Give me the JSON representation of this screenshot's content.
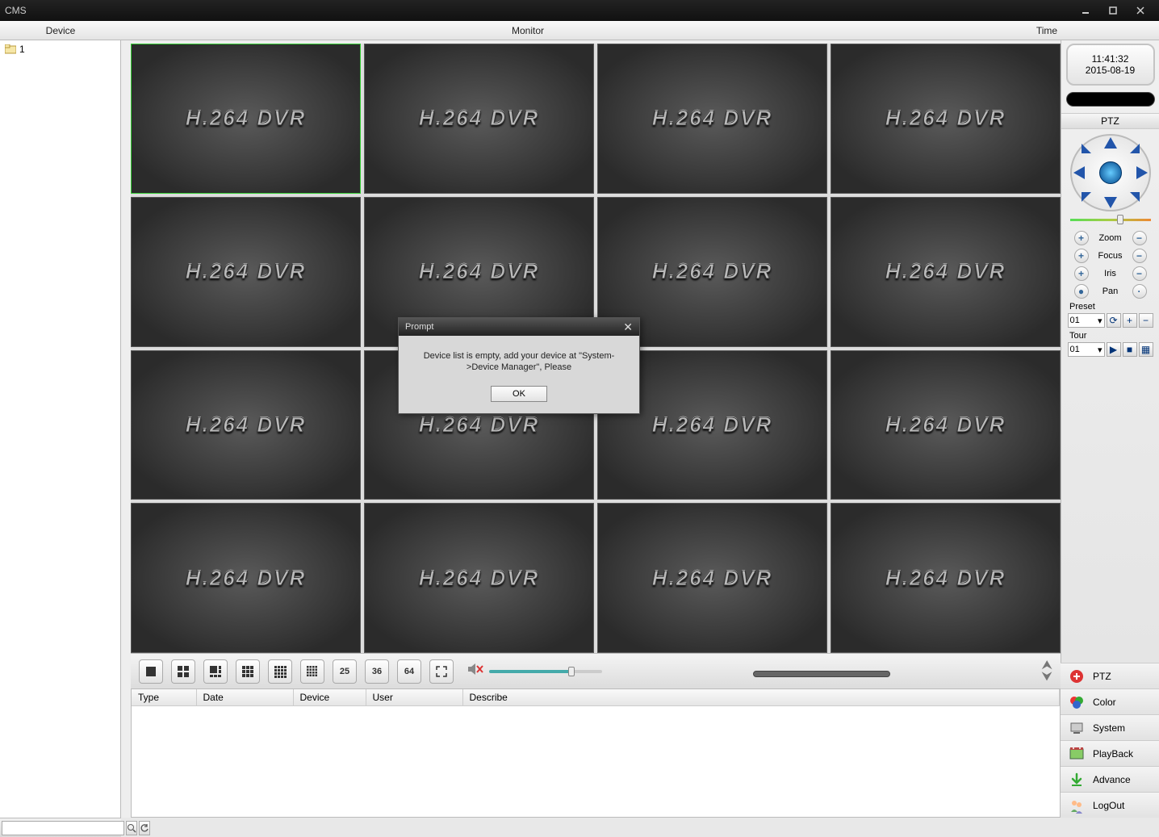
{
  "window": {
    "title": "CMS"
  },
  "header": {
    "device": "Device",
    "monitor": "Monitor",
    "time": "Time"
  },
  "tree": {
    "root_label": "1"
  },
  "clock": {
    "time": "11:41:32",
    "date": "2015-08-19"
  },
  "ptz": {
    "header": "PTZ",
    "zoom": "Zoom",
    "focus": "Focus",
    "iris": "Iris",
    "pan": "Pan",
    "preset": "Preset",
    "tour": "Tour",
    "preset_value": "01",
    "tour_value": "01"
  },
  "video": {
    "placeholder_text": "H.264 DVR"
  },
  "toolbar": {
    "btn_25": "25",
    "btn_36": "36",
    "btn_64": "64"
  },
  "log": {
    "columns": [
      "Type",
      "Date",
      "Device",
      "User",
      "Describe"
    ]
  },
  "right_menu": {
    "ptz": "PTZ",
    "color": "Color",
    "system": "System",
    "playback": "PlayBack",
    "advance": "Advance",
    "logout": "LogOut"
  },
  "modal": {
    "title": "Prompt",
    "message": "Device list is empty, add your device at \"System->Device Manager\", Please",
    "ok": "OK"
  }
}
